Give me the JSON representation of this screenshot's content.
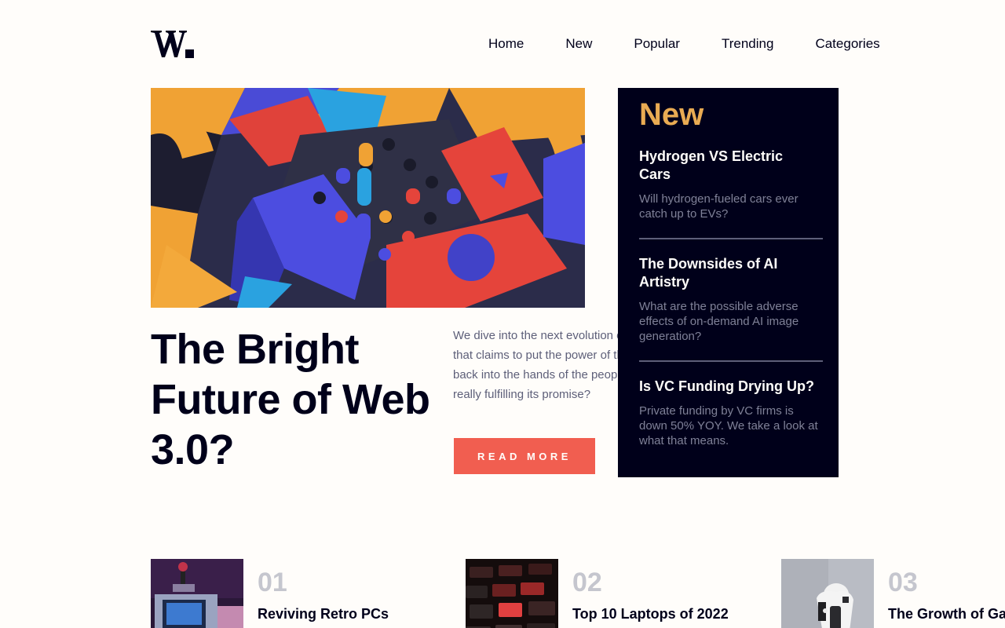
{
  "brand": {
    "logo_text": "W."
  },
  "nav": {
    "items": [
      {
        "label": "Home"
      },
      {
        "label": "New"
      },
      {
        "label": "Popular"
      },
      {
        "label": "Trending"
      },
      {
        "label": "Categories"
      }
    ]
  },
  "hero": {
    "title": "The Bright Future of Web 3.0?",
    "description": "We dive into the next evolution of the web that claims to put the power of the platforms back into the hands of the people. But is it really fulfilling its promise?",
    "button_label": "READ MORE"
  },
  "new_panel": {
    "heading": "New",
    "items": [
      {
        "title": "Hydrogen VS Electric Cars",
        "summary": "Will hydrogen-fueled cars ever catch up to EVs?"
      },
      {
        "title": "The Downsides of AI Artistry",
        "summary": "What are the possible adverse effects of on-demand AI image generation?"
      },
      {
        "title": "Is VC Funding Drying Up?",
        "summary": "Private funding by VC firms is down 50% YOY. We take a look at what that means."
      }
    ]
  },
  "cards": [
    {
      "number": "01",
      "title": "Reviving Retro PCs"
    },
    {
      "number": "02",
      "title": "Top 10 Laptops of 2022"
    },
    {
      "number": "03",
      "title": "The Growth of Gaming"
    }
  ],
  "colors": {
    "accent": "#f15e50",
    "gold": "#e9ab53",
    "dark": "#00001a",
    "muted": "#5d5f79"
  }
}
